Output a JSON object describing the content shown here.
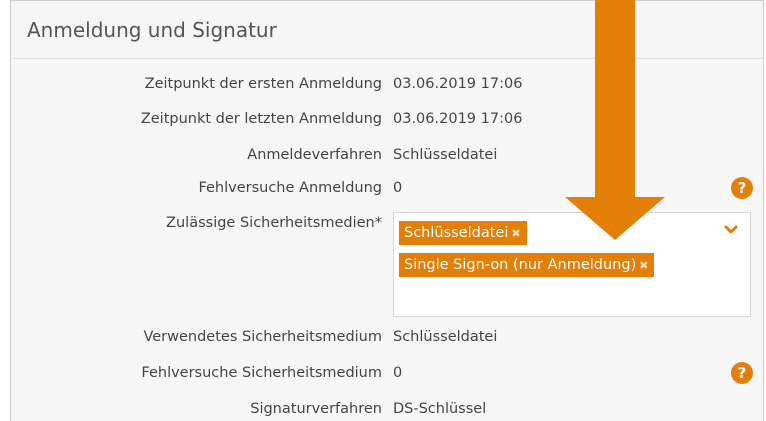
{
  "panel": {
    "title": "Anmeldung und Signatur"
  },
  "rows": [
    {
      "label": "Zeitpunkt der ersten Anmeldung",
      "value": "03.06.2019 17:06"
    },
    {
      "label": "Zeitpunkt der letzten Anmeldung",
      "value": "03.06.2019 17:06"
    },
    {
      "label": "Anmeldeverfahren",
      "value": "Schlüsseldatei"
    },
    {
      "label": "Fehlversuche Anmeldung",
      "value": "0"
    },
    {
      "label": "Zulässige Sicherheitsmedien*"
    },
    {
      "label": "Verwendetes Sicherheitsmedium",
      "value": "Schlüsseldatei"
    },
    {
      "label": "Fehlversuche Sicherheitsmedium",
      "value": "0"
    },
    {
      "label": "Signaturverfahren",
      "value": "DS-Schlüssel"
    }
  ],
  "media_chips": [
    {
      "label": "Schlüsseldatei",
      "remove_glyph": "✖"
    },
    {
      "label": "Single Sign-on (nur Anmeldung)",
      "remove_glyph": "✖"
    }
  ],
  "help_glyph": "?",
  "colors": {
    "accent": "#e37f07",
    "panel_bg": "#f6f6f6",
    "text": "#444444"
  },
  "icons": {
    "help": "question-circle-icon",
    "dropdown": "chevron-down-icon",
    "chip_remove": "close-icon",
    "overlay": "down-arrow-annotation"
  }
}
